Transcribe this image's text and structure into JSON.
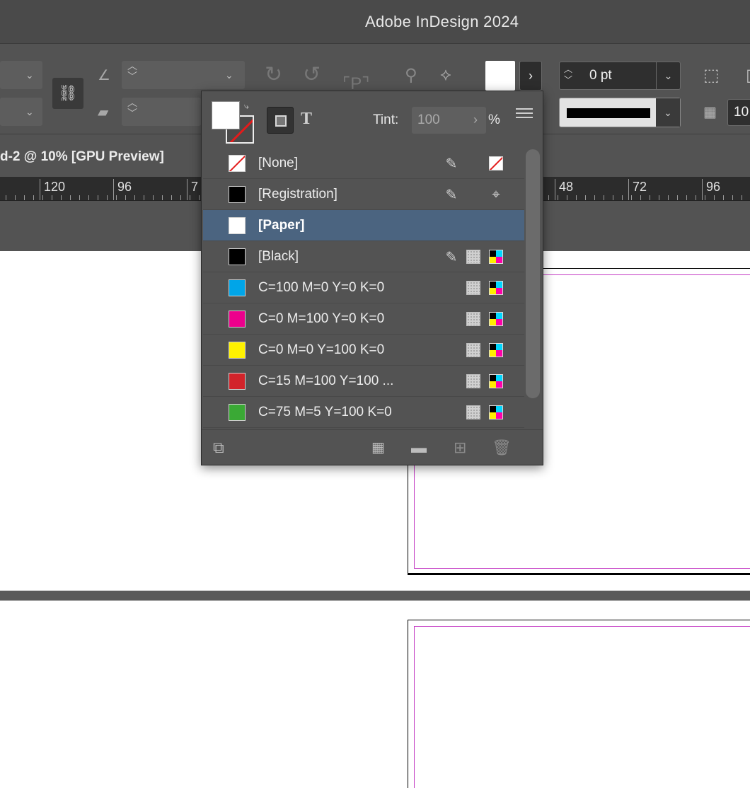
{
  "app": {
    "title": "Adobe InDesign 2024"
  },
  "control_bar": {
    "stroke_weight": "0 pt",
    "opacity_value": "10",
    "stroke_color": "#000000",
    "fill_preview_color": "#ffffff"
  },
  "document": {
    "tab_title": "d-2 @ 10% [GPU Preview]",
    "ruler_labels": [
      "120",
      "96",
      "7",
      "48",
      "72",
      "96"
    ]
  },
  "swatches_panel": {
    "tint_label": "Tint:",
    "tint_value": "100",
    "percent": "%",
    "swatches": [
      {
        "name": "[None]",
        "color": "none",
        "type": "none",
        "locked": true,
        "selected": false
      },
      {
        "name": "[Registration]",
        "color": "#000000",
        "type": "registration",
        "locked": true,
        "selected": false
      },
      {
        "name": "[Paper]",
        "color": "#ffffff",
        "type": "plain",
        "locked": false,
        "selected": true
      },
      {
        "name": "[Black]",
        "color": "#000000",
        "type": "cmyk",
        "locked": true,
        "selected": false
      },
      {
        "name": "C=100 M=0 Y=0 K=0",
        "color": "#00a5e8",
        "type": "cmyk",
        "locked": false,
        "selected": false
      },
      {
        "name": "C=0 M=100 Y=0 K=0",
        "color": "#ec008c",
        "type": "cmyk",
        "locked": false,
        "selected": false
      },
      {
        "name": "C=0 M=0 Y=100 K=0",
        "color": "#fff200",
        "type": "cmyk",
        "locked": false,
        "selected": false
      },
      {
        "name": "C=15 M=100 Y=100 ...",
        "color": "#d2232a",
        "type": "cmyk",
        "locked": false,
        "selected": false
      },
      {
        "name": "C=75 M=5 Y=100 K=0",
        "color": "#3aa935",
        "type": "cmyk",
        "locked": false,
        "selected": false
      }
    ]
  },
  "colors": {
    "selection": "#4b6480",
    "margin_guide": "#c43cc4"
  }
}
